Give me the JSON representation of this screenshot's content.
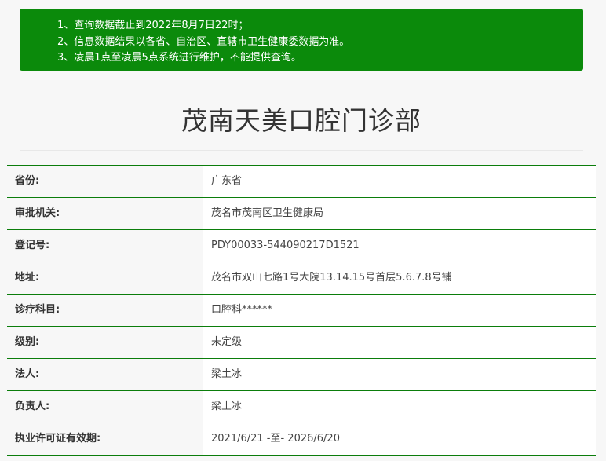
{
  "notice": {
    "lines": [
      "1、查询数据截止到2022年8月7日22时；",
      "2、信息数据结果以各省、自治区、直辖市卫生健康委数据为准。",
      "3、凌晨1点至凌晨5点系统进行维护，不能提供查询。"
    ]
  },
  "clinic": {
    "name": "茂南天美口腔门诊部"
  },
  "info": {
    "rows": [
      {
        "label": "省份:",
        "value": "广东省"
      },
      {
        "label": "审批机关:",
        "value": "茂名市茂南区卫生健康局"
      },
      {
        "label": "登记号:",
        "value": "PDY00033-544090217D1521"
      },
      {
        "label": "地址:",
        "value": "茂名市双山七路1号大院13.14.15号首层5.6.7.8号铺"
      },
      {
        "label": "诊疗科目:",
        "value": "口腔科******"
      },
      {
        "label": "级别:",
        "value": "未定级"
      },
      {
        "label": "法人:",
        "value": "梁土冰"
      },
      {
        "label": "负责人:",
        "value": "梁土冰"
      },
      {
        "label": "执业许可证有效期:",
        "value": "2021/6/21 -至- 2026/6/20"
      }
    ]
  },
  "colors": {
    "notice_bg": "#0b8a0b",
    "row_border": "#0b7d0b",
    "page_bg": "#f7f7f7"
  }
}
